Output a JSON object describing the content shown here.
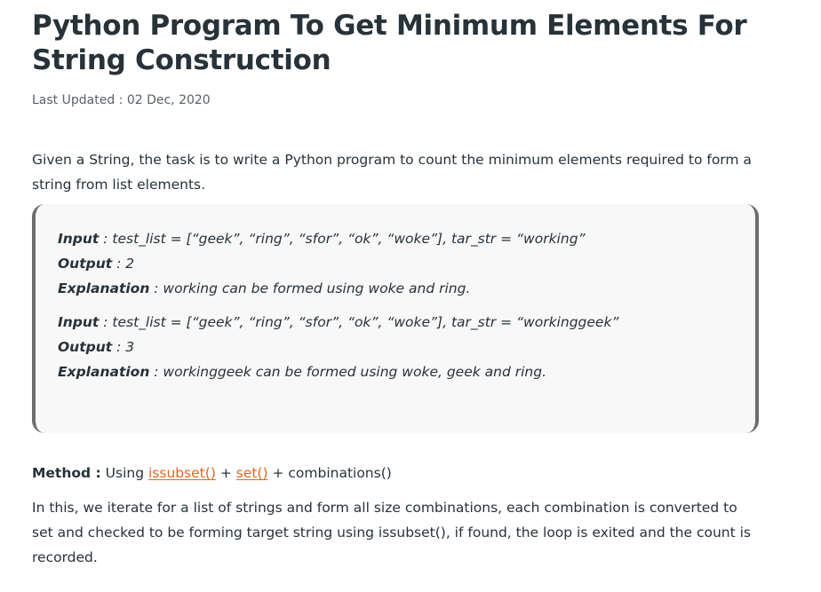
{
  "article": {
    "title": "Python Program To Get Minimum Elements For String Construction",
    "last_updated": "Last Updated : 02 Dec, 2020",
    "intro": "Given a String, the task is to write a Python program to count the minimum elements required to form a string from list elements.",
    "examples": [
      {
        "input_label": "Input",
        "input_text": " : test_list = [“geek”, “ring”, “sfor”, “ok”, “woke”], tar_str = “working”",
        "output_label": "Output",
        "output_text": " : 2",
        "explanation_label": "Explanation",
        "explanation_text": " : working can be formed using woke and ring."
      },
      {
        "input_label": "Input",
        "input_text": " : test_list = [“geek”, “ring”, “sfor”, “ok”, “woke”], tar_str = “workinggeek”",
        "output_label": "Output",
        "output_text": " : 3",
        "explanation_label": "Explanation",
        "explanation_text": " : workinggeek can be formed using woke, geek and ring."
      }
    ],
    "method": {
      "label": "Method :",
      "prefix": " Using ",
      "link1": "issubset()",
      "sep1": " + ",
      "link2": "set()",
      "suffix": " + combinations()"
    },
    "description": "In this, we iterate for a list of strings and form all size combinations, each combination is converted to set and checked to be forming target string using issubset(), if found, the loop is exited and the count is recorded."
  },
  "colors": {
    "text": "#273239",
    "link": "#e0661f",
    "box_background": "#f8f8f8",
    "box_border": "#6d6d6d"
  }
}
